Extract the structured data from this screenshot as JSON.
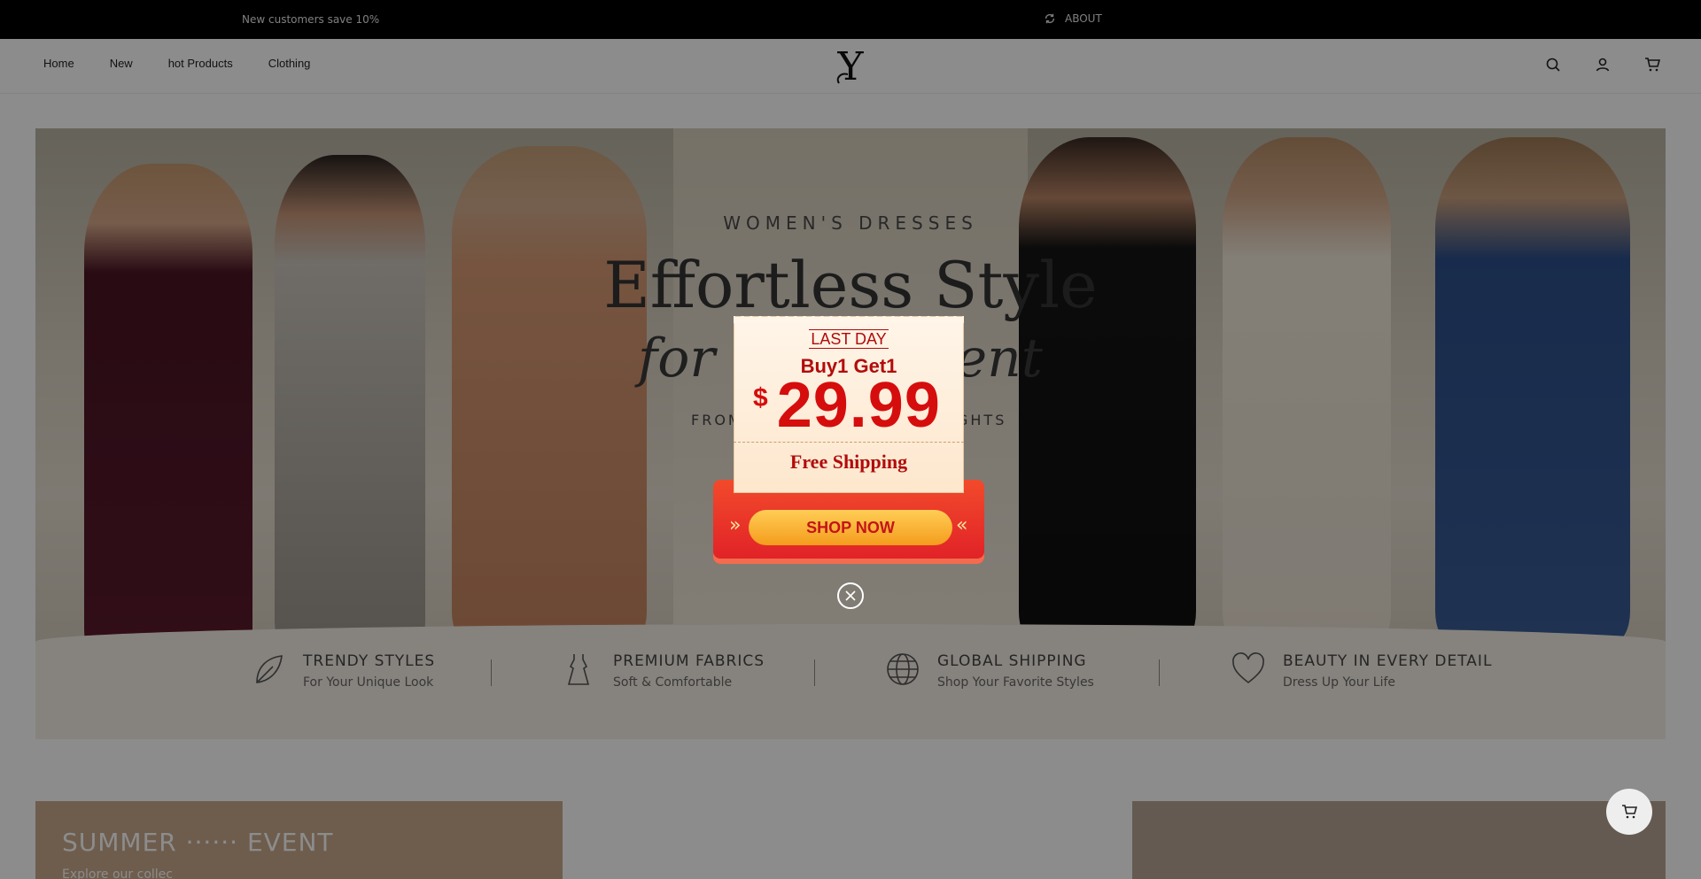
{
  "topbar": {
    "promo": "New customers save 10%",
    "about_label": "ABOUT"
  },
  "nav": {
    "items": [
      "Home",
      "New",
      "hot Products",
      "Clothing"
    ]
  },
  "brand": {
    "logo_letter": "Y"
  },
  "hero": {
    "eyebrow": "WOMEN'S DRESSES",
    "headline": "Effortless Style",
    "script_partial_left": "for",
    "script_partial_right": "nent",
    "from_left": "FROM",
    "from_right": "GHTS",
    "features": [
      {
        "title": "TRENDY STYLES",
        "subtitle": "For Your Unique Look",
        "icon": "leaf-icon"
      },
      {
        "title": "PREMIUM FABRICS",
        "subtitle": "Soft & Comfortable",
        "icon": "dress-icon"
      },
      {
        "title": "GLOBAL SHIPPING",
        "subtitle": "Shop Your Favorite Styles",
        "icon": "globe-icon"
      },
      {
        "title": "BEAUTY IN EVERY DETAIL",
        "subtitle": "Dress Up Your Life",
        "icon": "heart-icon"
      }
    ]
  },
  "cards": {
    "summer_title": "SUMMER",
    "summer_title_tail": "EVENT",
    "summer_sub": "Explore our collec"
  },
  "popup": {
    "tag": "LAST DAY",
    "offer": "Buy1 Get1",
    "currency": "$",
    "price": "29.99",
    "shipping": "Free Shipping",
    "cta": "SHOP NOW"
  },
  "colors": {
    "accent_red": "#d60d0d",
    "button_gold": "#f49c1d",
    "overlay": "rgba(0,0,0,0.45)"
  }
}
